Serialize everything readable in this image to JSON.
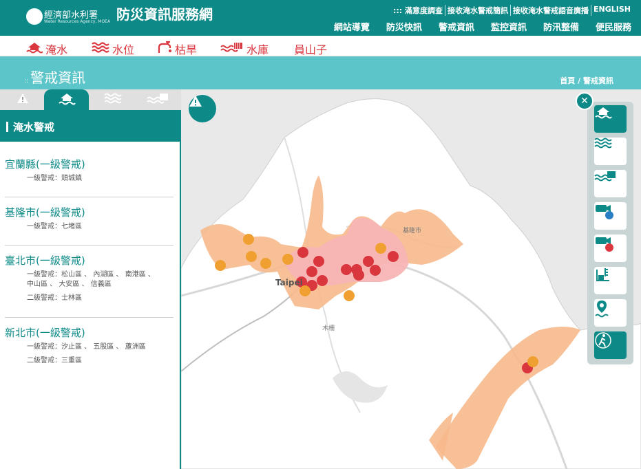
{
  "header": {
    "agency_name": "經濟部水利署",
    "agency_en": "Water Resources Agency, MOEA",
    "site_title": "防災資訊服務網",
    "top_links": [
      "::: 滿意度調查",
      "接收淹水警戒簡訊",
      "接收淹水警戒語音廣播",
      "ENGLISH"
    ],
    "main_nav": [
      "網站導覽",
      "防災快訊",
      "警戒資訊",
      "監控資訊",
      "防汛整備",
      "便民服務"
    ]
  },
  "subnav": [
    {
      "icon": "flood-house-icon",
      "label": "淹水"
    },
    {
      "icon": "water-level-icon",
      "label": "水位"
    },
    {
      "icon": "drought-tap-icon",
      "label": "枯旱"
    },
    {
      "icon": "reservoir-icon",
      "label": "水庫"
    },
    {
      "icon": "",
      "label": "員山子"
    }
  ],
  "banner": {
    "prefix": "::",
    "title": "警戒資訊",
    "breadcrumb": "首頁 / 警戒資訊"
  },
  "sidebar": {
    "tabs": [
      {
        "icon": "warning-icon",
        "active": false
      },
      {
        "icon": "flood-house-icon",
        "active": true
      },
      {
        "icon": "water-level-icon",
        "active": false
      },
      {
        "icon": "reservoir-icon",
        "active": false
      }
    ],
    "panel_title": "淹水警戒",
    "counties": [
      {
        "name": "宜蘭縣(一級警戒)",
        "lines": [
          "一級警戒：頭城鎮"
        ]
      },
      {
        "name": "基隆市(一級警戒)",
        "lines": [
          "一級警戒：七堵區"
        ]
      },
      {
        "name": "臺北市(一級警戒)",
        "lines": [
          "一級警戒：松山區 、 內湖區 、 南港區 、",
          "中山區 、 大安區 、 信義區",
          "二級警戒：士林區"
        ]
      },
      {
        "name": "新北市(一級警戒)",
        "lines": [
          "一級警戒：汐止區 、 五股區 、 蘆洲區",
          "二級警戒：三重區"
        ]
      }
    ]
  },
  "map": {
    "labels": {
      "city": "Taipei",
      "keelung": "基隆市",
      "mucha": "木柵"
    },
    "colors": {
      "level1": "#f7b5b5",
      "level2": "#f7b98b",
      "marker_red": "#d9363e",
      "marker_orange": "#f0a030",
      "accent": "#0d8a88"
    }
  },
  "toolbar": [
    {
      "icon": "flood-house-icon",
      "active": true
    },
    {
      "icon": "water-level-icon",
      "active": false
    },
    {
      "icon": "reservoir-icon",
      "active": false
    },
    {
      "icon": "camera-water-icon",
      "active": false
    },
    {
      "icon": "camera-warning-icon",
      "active": false
    },
    {
      "icon": "water-gauge-icon",
      "active": false
    },
    {
      "icon": "location-water-icon",
      "active": false
    },
    {
      "icon": "evacuation-icon",
      "active": true
    }
  ]
}
